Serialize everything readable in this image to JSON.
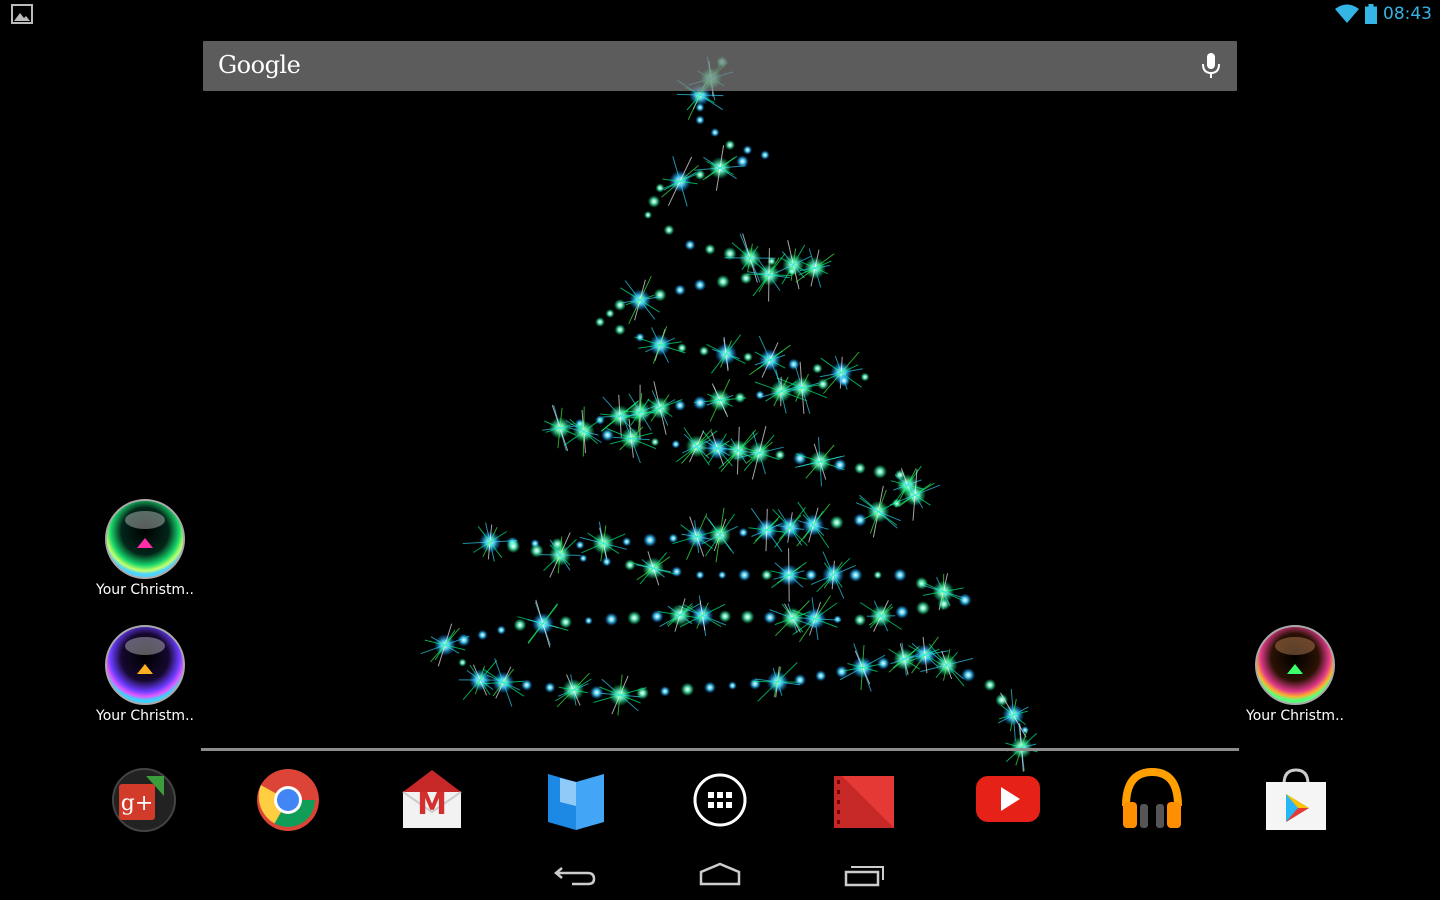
{
  "status_bar": {
    "time": "08:43",
    "accent_color": "#33b5e5",
    "left_notification_icon": "gallery-icon",
    "right_icons": [
      "wifi-icon",
      "battery-icon"
    ]
  },
  "search": {
    "logo_text": "Google",
    "voice_icon": "mic-icon"
  },
  "desktop": {
    "shortcuts": [
      {
        "label": "Your Christm..",
        "icon": "christmas-orb-green-icon"
      },
      {
        "label": "Your Christm..",
        "icon": "christmas-orb-purple-icon"
      },
      {
        "label": "Your Christm..",
        "icon": "christmas-orb-orange-icon"
      }
    ]
  },
  "dock": {
    "apps": [
      {
        "name": "Google+",
        "icon": "google-plus-icon",
        "glyph": "g+"
      },
      {
        "name": "Chrome",
        "icon": "chrome-icon"
      },
      {
        "name": "Gmail",
        "icon": "gmail-icon",
        "glyph": "M"
      },
      {
        "name": "Play Books",
        "icon": "play-books-icon"
      },
      {
        "name": "All apps",
        "icon": "app-drawer-icon"
      },
      {
        "name": "Play Movies",
        "icon": "play-movies-icon"
      },
      {
        "name": "YouTube",
        "icon": "youtube-icon"
      },
      {
        "name": "Play Music",
        "icon": "play-music-icon"
      },
      {
        "name": "Play Store",
        "icon": "play-store-icon"
      }
    ]
  },
  "nav": {
    "buttons": [
      "back-icon",
      "home-icon",
      "recents-icon"
    ]
  },
  "wallpaper": {
    "name": "christmas-tree-live-wallpaper",
    "colors": [
      "#00ff88",
      "#33ddff",
      "#ffffff",
      "#44ff44"
    ]
  }
}
